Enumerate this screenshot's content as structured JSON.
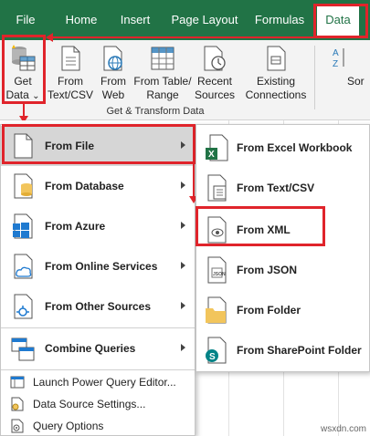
{
  "tabs": [
    {
      "label": "File"
    },
    {
      "label": "Home"
    },
    {
      "label": "Insert"
    },
    {
      "label": "Page Layout"
    },
    {
      "label": "Formulas"
    },
    {
      "label": "Data"
    }
  ],
  "ribbon": {
    "get_data": {
      "line1": "Get",
      "line2": "Data",
      "dropdown": "⌄"
    },
    "from_text_csv": {
      "line1": "From",
      "line2": "Text/CSV"
    },
    "from_web": {
      "line1": "From",
      "line2": "Web"
    },
    "from_table_range": {
      "line1": "From Table/",
      "line2": "Range"
    },
    "recent_sources": {
      "line1": "Recent",
      "line2": "Sources"
    },
    "existing_connections": {
      "line1": "Existing",
      "line2": "Connections"
    },
    "sort": {
      "line1": "Sor"
    },
    "group_label": "Get & Transform Data"
  },
  "menu": {
    "items": [
      {
        "label": "From File"
      },
      {
        "label": "From Database"
      },
      {
        "label": "From Azure"
      },
      {
        "label": "From Online Services"
      },
      {
        "label": "From Other Sources"
      },
      {
        "label": "Combine Queries"
      }
    ],
    "small_items": [
      {
        "label": "Launch Power Query Editor..."
      },
      {
        "label": "Data Source Settings..."
      },
      {
        "label": "Query Options"
      }
    ]
  },
  "submenu": {
    "items": [
      {
        "label": "From Excel Workbook"
      },
      {
        "label": "From Text/CSV"
      },
      {
        "label": "From XML"
      },
      {
        "label": "From JSON"
      },
      {
        "label": "From Folder"
      },
      {
        "label": "From SharePoint Folder"
      }
    ]
  },
  "watermark": "wsxdn.com",
  "colors": {
    "excel_green": "#217346",
    "highlight_red": "#e0242b"
  }
}
